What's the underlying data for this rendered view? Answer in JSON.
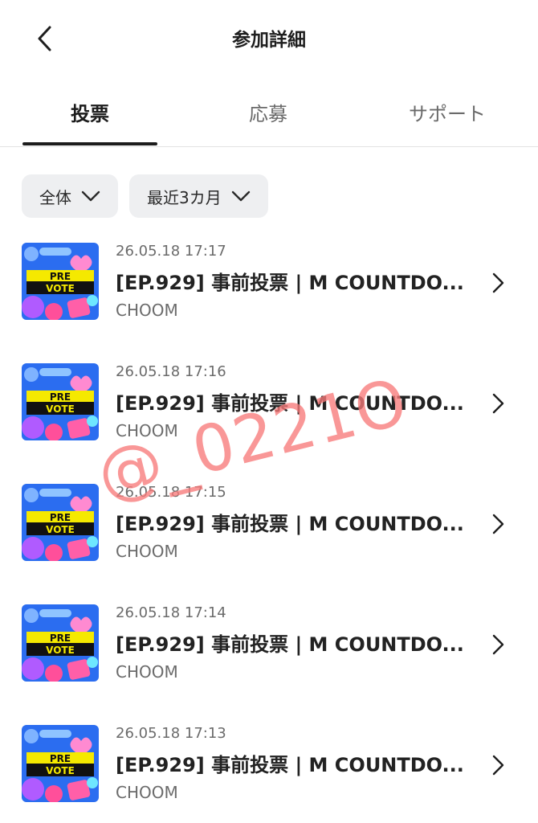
{
  "header": {
    "title": "参加詳細",
    "back_icon": "chevron-left-icon"
  },
  "tabs": [
    {
      "label": "投票",
      "active": true
    },
    {
      "label": "応募",
      "active": false
    },
    {
      "label": "サポート",
      "active": false
    }
  ],
  "filters": [
    {
      "label": "全体",
      "icon": "chevron-down-icon"
    },
    {
      "label": "最近3カ月",
      "icon": "chevron-down-icon"
    }
  ],
  "items": [
    {
      "date": "26.05.18 17:17",
      "title": "[EP.929] 事前投票 | M COUNTDO...",
      "subtitle": "CHOOM",
      "thumb_line1": "PRE",
      "thumb_line2": "VOTE"
    },
    {
      "date": "26.05.18 17:16",
      "title": "[EP.929] 事前投票 | M COUNTDO...",
      "subtitle": "CHOOM",
      "thumb_line1": "PRE",
      "thumb_line2": "VOTE"
    },
    {
      "date": "26.05.18 17:15",
      "title": "[EP.929] 事前投票 | M COUNTDO...",
      "subtitle": "CHOOM",
      "thumb_line1": "PRE",
      "thumb_line2": "VOTE"
    },
    {
      "date": "26.05.18 17:14",
      "title": "[EP.929] 事前投票 | M COUNTDO...",
      "subtitle": "CHOOM",
      "thumb_line1": "PRE",
      "thumb_line2": "VOTE"
    },
    {
      "date": "26.05.18 17:13",
      "title": "[EP.929] 事前投票 | M COUNTDO...",
      "subtitle": "CHOOM",
      "thumb_line1": "PRE",
      "thumb_line2": "VOTE"
    }
  ],
  "watermark": "@_0221O",
  "colors": {
    "text_primary": "#1f1f1f",
    "text_secondary": "#6b6b6b",
    "chip_bg": "#eeeff1",
    "divider": "#e3e3e3",
    "watermark": "#f77a7a",
    "thumb_bg": "#2b6df0",
    "thumb_banner": "#f5e900"
  }
}
